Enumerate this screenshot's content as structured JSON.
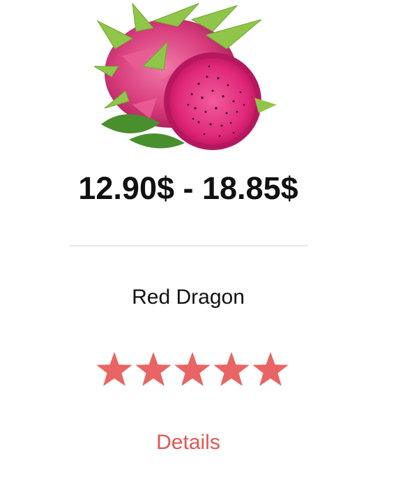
{
  "product": {
    "image_icon": "dragon-fruit-image",
    "price": "12.90$ - 18.85$",
    "name": "Red Dragon",
    "rating": {
      "value": 5,
      "max": 5
    },
    "details_label": "Details"
  },
  "colors": {
    "star": "#e96464",
    "details_link": "#e05656",
    "divider": "#e6e6e6",
    "text": "#111111"
  }
}
